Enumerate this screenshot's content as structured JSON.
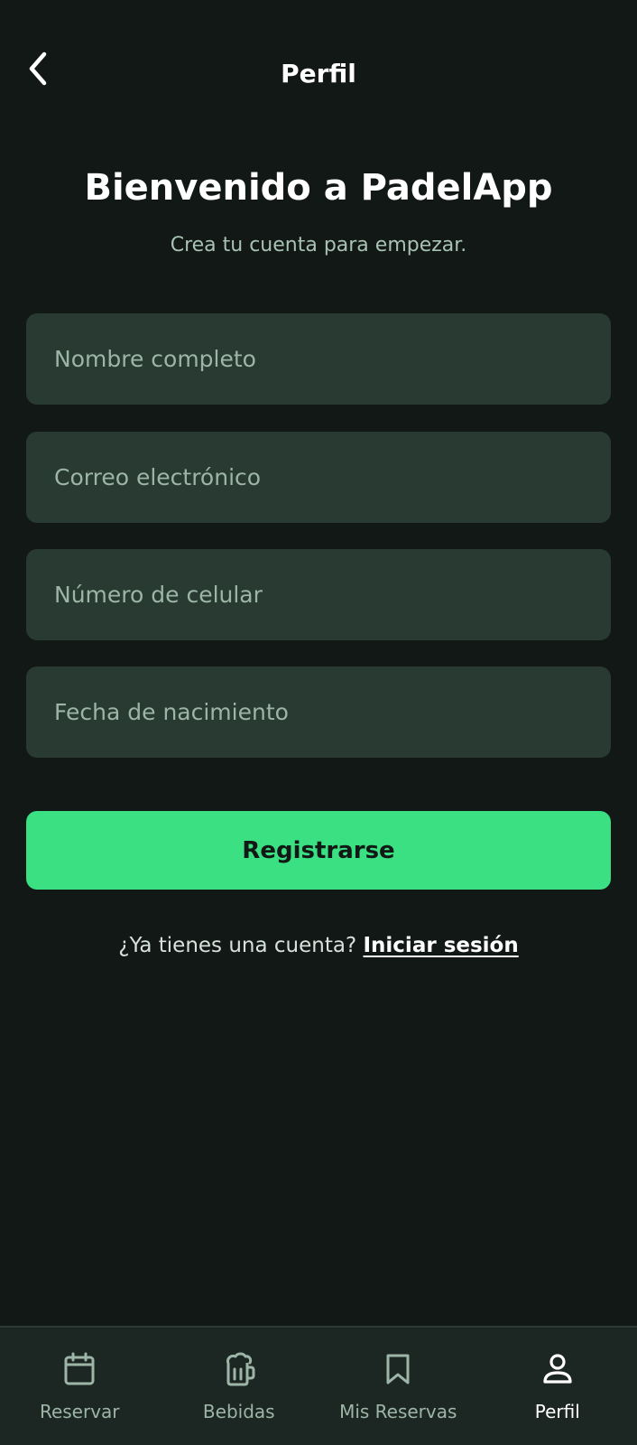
{
  "header": {
    "title": "Perfil",
    "back_icon": "chevron-left-icon"
  },
  "welcome": {
    "title": "Bienvenido a PadelApp",
    "subtitle": "Crea tu cuenta para empezar."
  },
  "form": {
    "full_name": {
      "placeholder": "Nombre completo",
      "value": ""
    },
    "email": {
      "placeholder": "Correo electrónico",
      "value": ""
    },
    "phone": {
      "placeholder": "Número de celular",
      "value": ""
    },
    "birth_date": {
      "placeholder": "Fecha de nacimiento",
      "value": ""
    },
    "submit_label": "Registrarse"
  },
  "login_prompt": {
    "text": "¿Ya tienes una cuenta?",
    "link_label": "Iniciar sesión"
  },
  "bottom_nav": {
    "items": [
      {
        "label": "Reservar",
        "icon": "calendar-icon",
        "active": false
      },
      {
        "label": "Bebidas",
        "icon": "beer-mug-icon",
        "active": false
      },
      {
        "label": "Mis Reservas",
        "icon": "bookmark-icon",
        "active": false
      },
      {
        "label": "Perfil",
        "icon": "person-icon",
        "active": true
      }
    ]
  },
  "colors": {
    "background": "#111816",
    "field_background": "#283a31",
    "accent": "#3ae081",
    "muted_text": "#9db5a7",
    "nav_background": "#1c2723"
  }
}
